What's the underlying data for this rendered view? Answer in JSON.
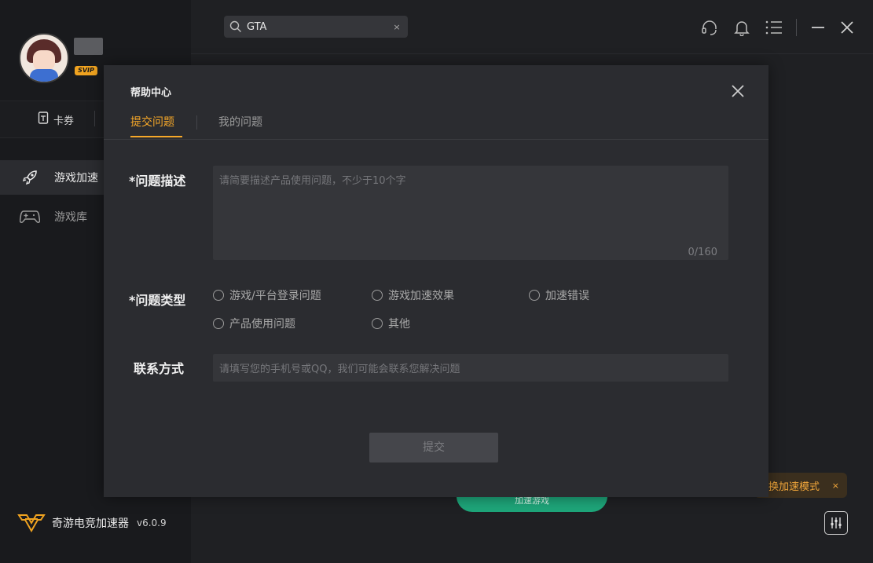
{
  "sidebar": {
    "badge": "SVIP",
    "coupon_label": "卡券",
    "nav": [
      {
        "label": "游戏加速",
        "icon": "rocket-icon"
      },
      {
        "label": "游戏库",
        "icon": "gamepad-icon"
      }
    ],
    "app_name": "奇游电竞加速器",
    "version": "v6.0.9"
  },
  "topbar": {
    "search_value": "GTA",
    "search_clear": "×",
    "icons": [
      "headset-icon",
      "bell-icon",
      "menu-icon",
      "minimize-icon",
      "close-icon"
    ]
  },
  "background": {
    "start_button_label": "加速游戏",
    "mode_tip": "换加速模式",
    "mode_tip_close": "×"
  },
  "modal": {
    "title": "帮助中心",
    "tabs": [
      {
        "label": "提交问题",
        "active": true
      },
      {
        "label": "我的问题",
        "active": false
      }
    ],
    "description": {
      "label": "*问题描述",
      "placeholder": "请简要描述产品使用问题，不少于10个字",
      "counter": "0/160"
    },
    "type": {
      "label": "*问题类型",
      "options": [
        "游戏/平台登录问题",
        "游戏加速效果",
        "加速错误",
        "产品使用问题",
        "其他"
      ]
    },
    "contact": {
      "label": "联系方式",
      "placeholder": "请填写您的手机号或QQ，我们可能会联系您解决问题"
    },
    "submit_label": "提交"
  },
  "colors": {
    "accent": "#f6a829",
    "green": "#1ea67a",
    "modal_bg": "#2b2c30",
    "sidebar_bg": "#191a1d"
  }
}
